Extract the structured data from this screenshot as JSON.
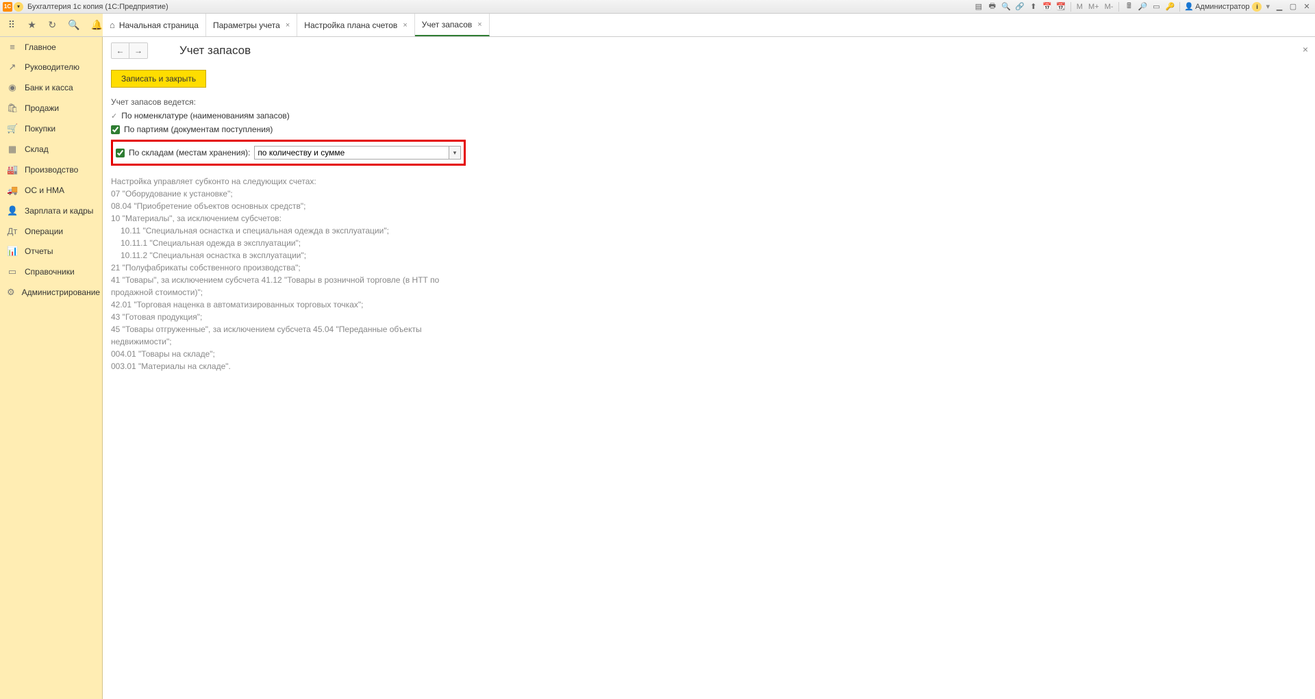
{
  "titlebar": {
    "logo_text": "1C",
    "title": "Бухгалтерия 1с копия  (1С:Предприятие)",
    "user": "Администратор",
    "m_label": "M",
    "m_plus": "M+",
    "m_minus": "M-"
  },
  "tabs": {
    "home": "Начальная страница",
    "items": [
      {
        "label": "Параметры учета"
      },
      {
        "label": "Настройка плана счетов"
      },
      {
        "label": "Учет запасов",
        "active": true
      }
    ]
  },
  "sidebar": {
    "items": [
      {
        "icon": "≡",
        "label": "Главное"
      },
      {
        "icon": "↗",
        "label": "Руководителю"
      },
      {
        "icon": "◉",
        "label": "Банк и касса"
      },
      {
        "icon": "🛍",
        "label": "Продажи"
      },
      {
        "icon": "🛒",
        "label": "Покупки"
      },
      {
        "icon": "▦",
        "label": "Склад"
      },
      {
        "icon": "🏭",
        "label": "Производство"
      },
      {
        "icon": "🚚",
        "label": "ОС и НМА"
      },
      {
        "icon": "👤",
        "label": "Зарплата и кадры"
      },
      {
        "icon": "Дт",
        "label": "Операции"
      },
      {
        "icon": "📊",
        "label": "Отчеты"
      },
      {
        "icon": "▭",
        "label": "Справочники"
      },
      {
        "icon": "⚙",
        "label": "Администрирование"
      }
    ]
  },
  "page": {
    "title": "Учет запасов",
    "save_close": "Записать и закрыть",
    "section_label": "Учет запасов ведется:",
    "fixed_check": "По номенклатуре (наименованиям запасов)",
    "check_batches": "По партиям (документам поступления)",
    "check_warehouses": "По складам (местам хранения):",
    "dropdown_value": "по количеству и сумме",
    "info_lines": [
      "Настройка управляет субконто на следующих счетах:",
      "07 \"Оборудование к установке\";",
      "08.04 \"Приобретение объектов основных средств\";",
      "10 \"Материалы\", за исключением субсчетов:",
      "   10.11 \"Специальная оснастка и специальная одежда в эксплуатации\";",
      "   10.11.1 \"Специальная одежда в эксплуатации\";",
      "   10.11.2 \"Специальная оснастка в эксплуатации\";",
      "21 \"Полуфабрикаты собственного производства\";",
      "41 \"Товары\", за исключением субсчета 41.12 \"Товары в розничной торговле (в НТТ по продажной стоимости)\";",
      "42.01 \"Торговая наценка в автоматизированных торговых точках\";",
      "43 \"Готовая продукция\";",
      "45 \"Товары отгруженные\", за исключением субсчета 45.04 \"Переданные объекты недвижимости\";",
      "004.01 \"Товары на складе\";",
      "003.01 \"Материалы на складе\"."
    ]
  }
}
